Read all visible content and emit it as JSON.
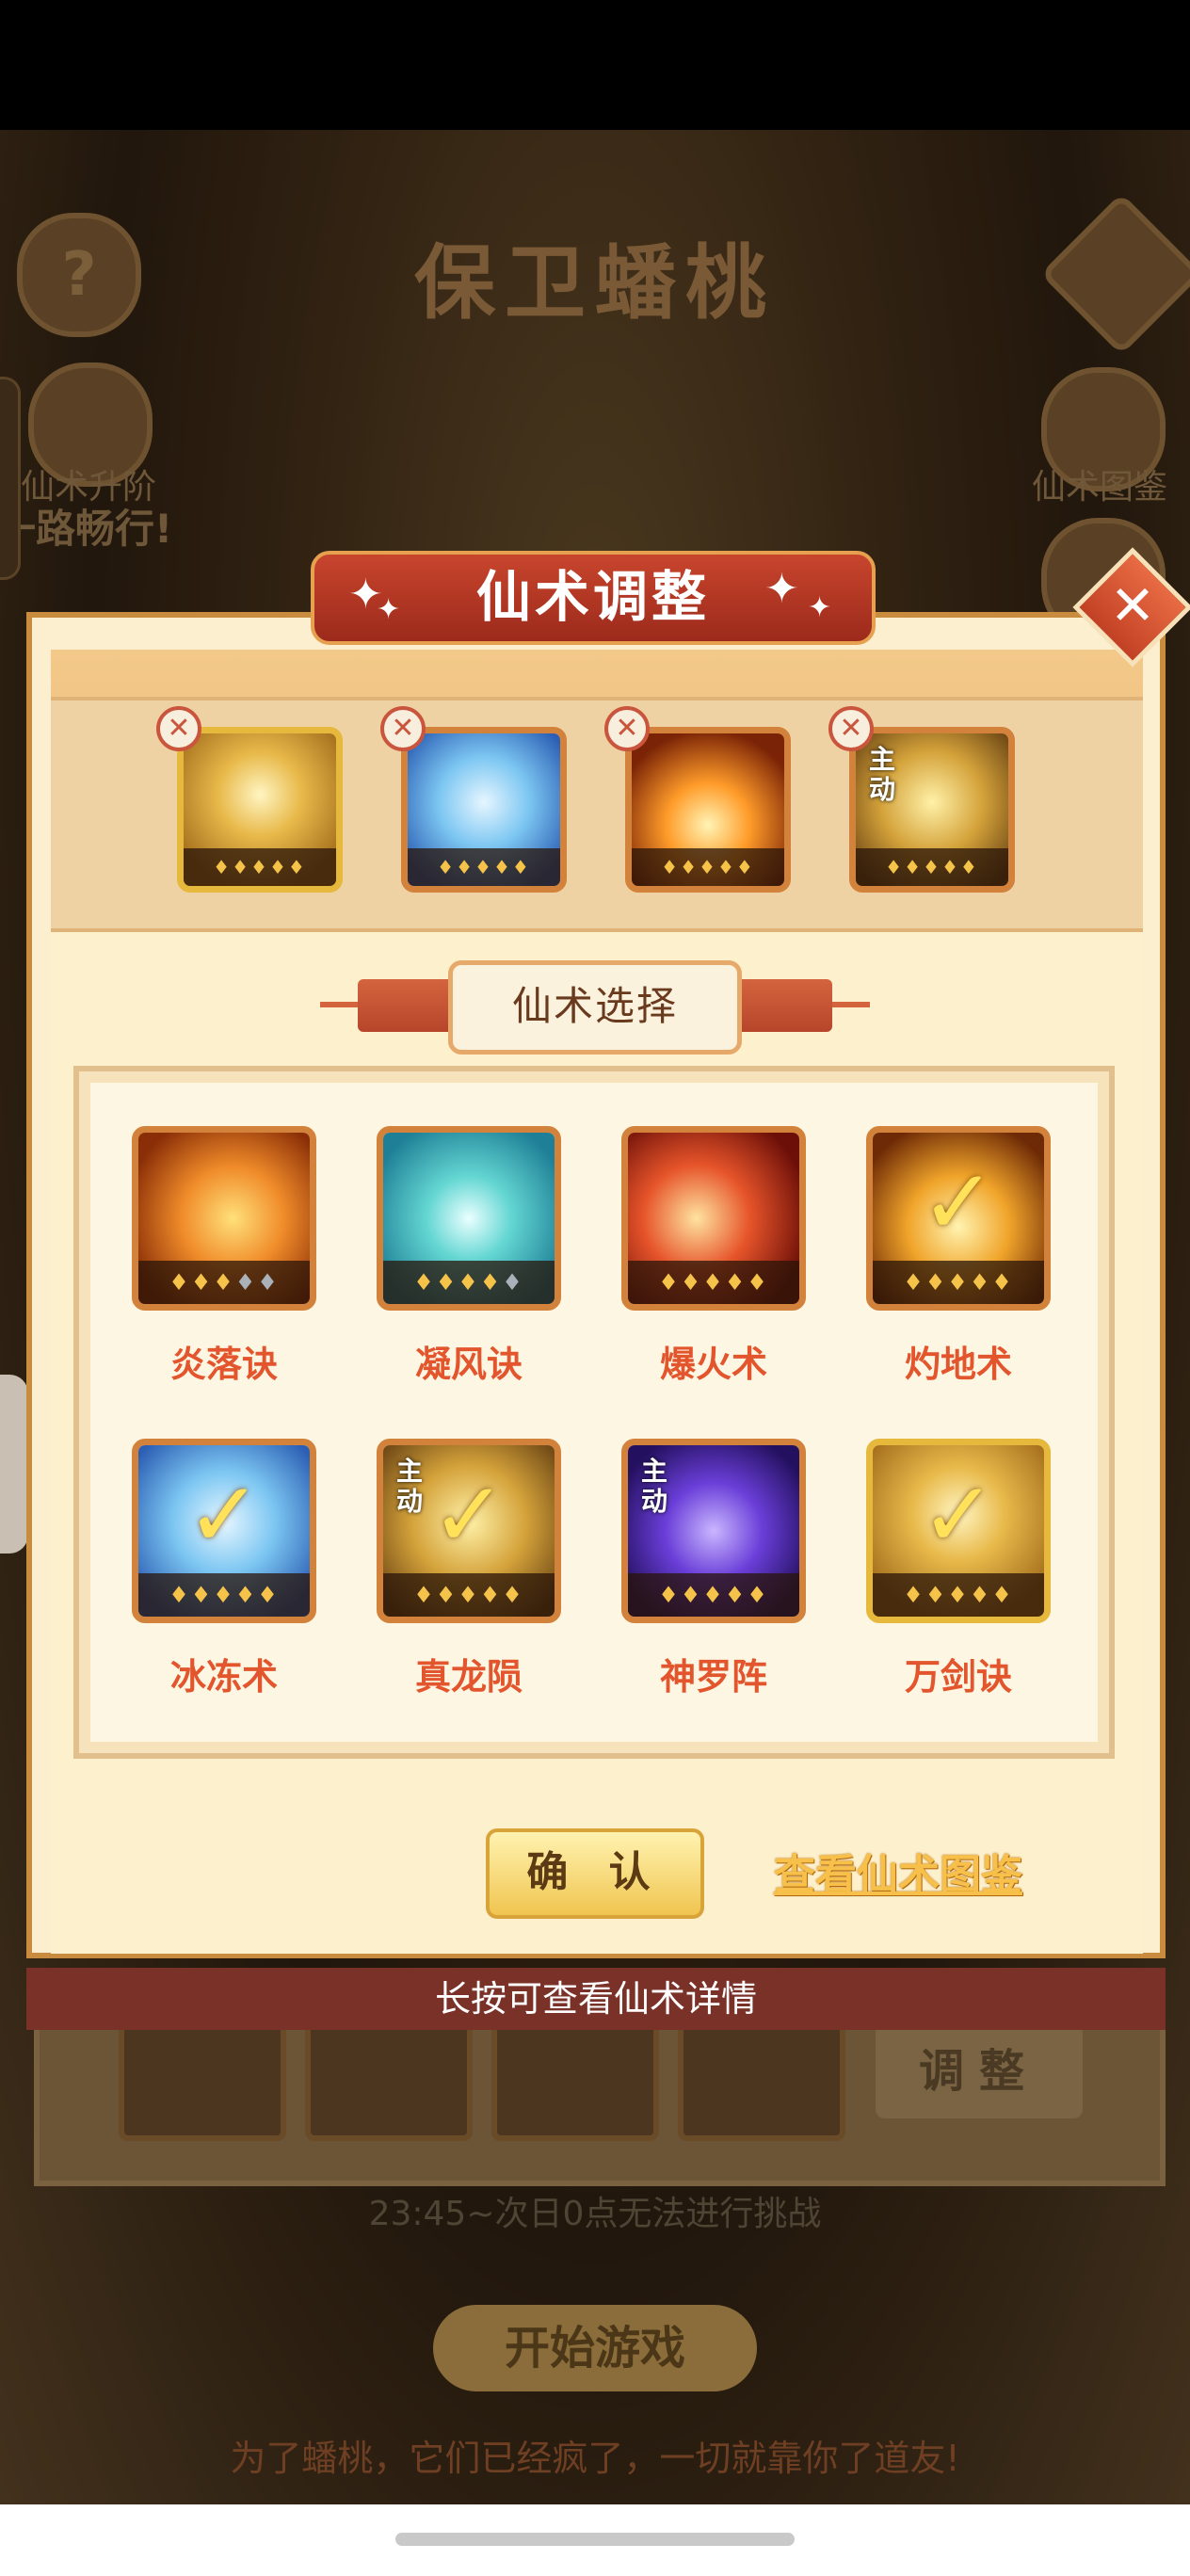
{
  "background": {
    "title": "保卫蟠桃",
    "help_icon": "?",
    "left_badge_label": "仙术升阶",
    "left_banner": "一路畅行!",
    "right_badge_label": "仙术图鉴",
    "adjust_label": "调整",
    "notice": "23:45~次日0点无法进行挑战",
    "start_button": "开始游戏",
    "tagline": "为了蟠桃，它们已经疯了，一切就靠你了道友!"
  },
  "dialog": {
    "title": "仙术调整",
    "close_icon": "close-icon",
    "equipped": [
      {
        "name": "万剑诀",
        "icon": "sword-icon",
        "active": false,
        "level": 5
      },
      {
        "name": "冰冻术",
        "icon": "ice-icon",
        "active": false,
        "level": 5
      },
      {
        "name": "灼地术",
        "icon": "fire-icon",
        "active": false,
        "level": 5
      },
      {
        "name": "真龙陨",
        "icon": "dragon-icon",
        "active_label": "主动",
        "active": true,
        "level": 5
      }
    ],
    "select_header": "仙术选择",
    "skills": [
      {
        "name": "炎落诀",
        "icon": "flame-fall-icon",
        "stars_lit": 3,
        "stars_total": 5,
        "selected": false,
        "active_label": ""
      },
      {
        "name": "凝风诀",
        "icon": "wind-icon",
        "stars_lit": 4,
        "stars_total": 5,
        "selected": false,
        "active_label": ""
      },
      {
        "name": "爆火术",
        "icon": "burst-fire-icon",
        "stars_lit": 5,
        "stars_total": 5,
        "selected": false,
        "active_label": ""
      },
      {
        "name": "灼地术",
        "icon": "burn-ground-icon",
        "stars_lit": 5,
        "stars_total": 5,
        "selected": true,
        "active_label": ""
      },
      {
        "name": "冰冻术",
        "icon": "ice-icon",
        "stars_lit": 5,
        "stars_total": 5,
        "selected": true,
        "active_label": ""
      },
      {
        "name": "真龙陨",
        "icon": "dragon-icon",
        "stars_lit": 5,
        "stars_total": 5,
        "selected": true,
        "active_label": "主动"
      },
      {
        "name": "神罗阵",
        "icon": "divine-array-icon",
        "stars_lit": 5,
        "stars_total": 5,
        "selected": false,
        "active_label": "主动"
      },
      {
        "name": "万剑诀",
        "icon": "sword-icon",
        "stars_lit": 5,
        "stars_total": 5,
        "selected": true,
        "active_label": ""
      }
    ],
    "confirm_button": "确 认",
    "codex_link": "查看仙术图鉴",
    "hint": "长按可查看仙术详情"
  },
  "colors": {
    "title_ribbon": "#b8392a",
    "skill_name": "#e2552d",
    "hint_bar": "#7a3128",
    "codex_link": "#f6c04a"
  }
}
